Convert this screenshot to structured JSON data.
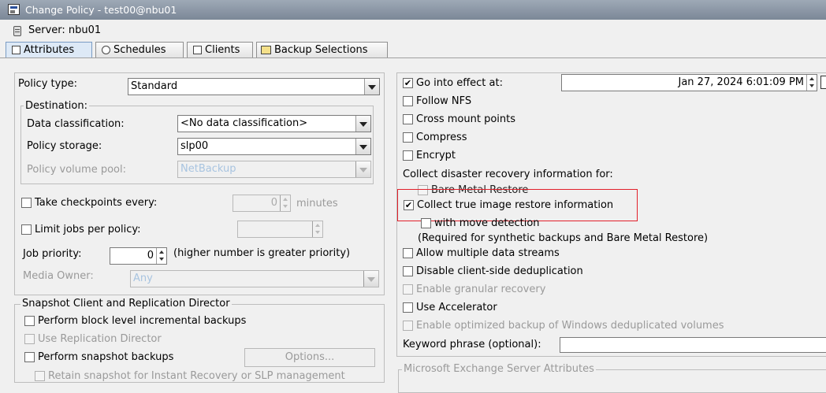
{
  "window": {
    "title": "Change Policy - test00@nbu01"
  },
  "server": {
    "label": "Server: nbu01"
  },
  "tabs": [
    {
      "label": "Attributes",
      "icon": "attributes-icon"
    },
    {
      "label": "Schedules",
      "icon": "schedules-icon"
    },
    {
      "label": "Clients",
      "icon": "clients-icon"
    },
    {
      "label": "Backup Selections",
      "icon": "backup-selections-icon"
    }
  ],
  "left": {
    "policy_type_label": "Policy type:",
    "policy_type_value": "Standard",
    "destination_title": "Destination:",
    "data_classification_label": "Data classification:",
    "data_classification_value": "<No data classification>",
    "policy_storage_label": "Policy storage:",
    "policy_storage_value": "slp00",
    "volume_pool_label": "Policy volume pool:",
    "volume_pool_value": "NetBackup",
    "checkpoints_label": "Take checkpoints every:",
    "checkpoints_value": "0",
    "checkpoints_unit": "minutes",
    "limit_jobs_label": "Limit jobs per policy:",
    "job_priority_label": "Job priority:",
    "job_priority_value": "0",
    "job_priority_hint": "(higher number is greater priority)",
    "media_owner_label": "Media Owner:",
    "media_owner_value": "Any",
    "snapshot_title": "Snapshot Client and Replication Director",
    "block_level_label": "Perform block level incremental backups",
    "replication_director_label": "Use Replication Director",
    "snapshot_backups_label": "Perform snapshot backups",
    "options_button": "Options...",
    "retain_snapshot_label": "Retain snapshot for Instant Recovery or SLP management"
  },
  "right": {
    "go_into_effect_label": "Go into effect at:",
    "go_into_effect_value": "Jan 27, 2024 6:01:09 PM",
    "follow_nfs_label": "Follow NFS",
    "cross_mount_label": "Cross mount points",
    "compress_label": "Compress",
    "encrypt_label": "Encrypt",
    "collect_dr_label": "Collect disaster recovery information for:",
    "bare_metal_label": "Bare Metal Restore",
    "true_image_label": "Collect true image restore information",
    "move_detection_label": "with move detection",
    "required_note": "(Required for synthetic backups and Bare Metal Restore)",
    "multiple_streams_label": "Allow multiple data streams",
    "disable_dedup_label": "Disable client-side deduplication",
    "granular_label": "Enable granular recovery",
    "accelerator_label": "Use Accelerator",
    "optimized_label": "Enable optimized backup of Windows deduplicated volumes",
    "keyword_label": "Keyword phrase (optional):",
    "exchange_title": "Microsoft Exchange Server Attributes"
  },
  "checkmark": "✔",
  "colors": {
    "highlight": "#e2202a",
    "active_tab": "#dde9f6",
    "disabled_text": "#9a9a9a"
  }
}
